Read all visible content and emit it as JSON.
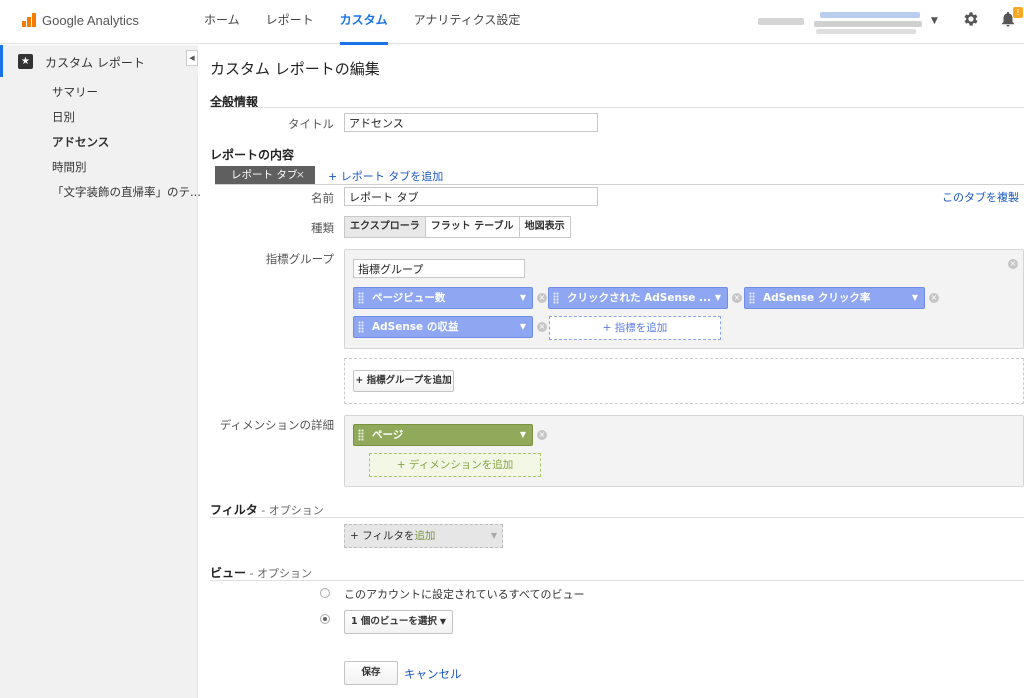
{
  "app": {
    "brand": "Google Analytics"
  },
  "nav": [
    "ホーム",
    "レポート",
    "カスタム",
    "アナリティクス設定"
  ],
  "nav_active": "カスタム",
  "notifications": {
    "badge": "!"
  },
  "sidebar": {
    "header": "カスタム レポート",
    "items": [
      {
        "label": "サマリー"
      },
      {
        "label": "日別"
      },
      {
        "label": "アドセンス",
        "active": true
      },
      {
        "label": "時間別"
      },
      {
        "label": "「文字装飾の直帰率」のテ..."
      }
    ]
  },
  "page": {
    "title": "カスタム レポートの編集"
  },
  "general": {
    "heading": "全般情報",
    "title_label": "タイトル",
    "title_value": "アドセンス"
  },
  "content": {
    "heading": "レポートの内容",
    "tab_chip": "レポート タブ",
    "add_tab": "+ レポート タブを追加",
    "name_label": "名前",
    "name_value": "レポート タブ",
    "duplicate_tab": "このタブを複製",
    "type_label": "種類",
    "types": [
      "エクスプローラ",
      "フラット テーブル",
      "地図表示"
    ],
    "active_type": "エクスプローラ",
    "metric_group_label": "指標グループ",
    "metric_group_name": "指標グループ",
    "metrics": [
      "ページビュー数",
      "クリックされた AdSense ...",
      "AdSense クリック率",
      "AdSense の収益"
    ],
    "add_metric": "+ 指標を追加",
    "add_metric_group": "+ 指標グループを追加",
    "dimension_label": "ディメンションの詳細",
    "dimensions": [
      "ページ"
    ],
    "add_dimension": "+ ディメンションを追加"
  },
  "filter": {
    "heading": "フィルタ",
    "optional": " - オプション",
    "add_filter_prefix": "+ フィルタを",
    "add_filter_suffix": "追加"
  },
  "view": {
    "heading": "ビュー",
    "optional": " - オプション",
    "option_all": "このアカウントに設定されているすべてのビュー",
    "option_select": "1 個のビューを選択",
    "selected": "option_select"
  },
  "actions": {
    "save": "保存",
    "cancel": "キャンセル"
  },
  "colors": {
    "accent": "#1a73e8",
    "metric_chip": "#8fa7f2",
    "dimension_chip": "#91a95b",
    "brand_orange": "#f57c00"
  }
}
